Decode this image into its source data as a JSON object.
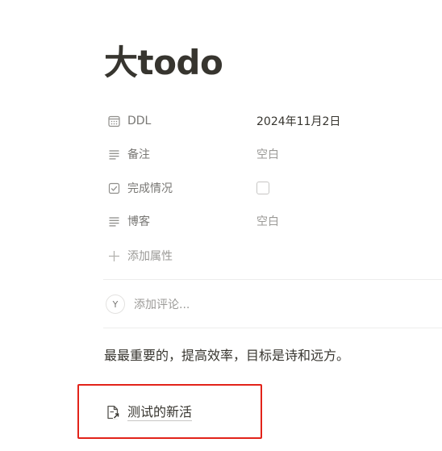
{
  "page": {
    "title": "大todo",
    "body_text": "最最重要的，提高效率，目标是诗和远方。"
  },
  "properties": [
    {
      "icon": "calendar-icon",
      "name": "DDL",
      "value": "2024年11月2日"
    },
    {
      "icon": "text-lines-icon",
      "name": "备注",
      "value": "空白"
    },
    {
      "icon": "checkbox-icon",
      "name": "完成情况",
      "value": ""
    },
    {
      "icon": "text-lines-icon",
      "name": "博客",
      "value": "空白"
    }
  ],
  "add_property_label": "添加属性",
  "comment": {
    "avatar_initial": "Y",
    "placeholder": "添加评论..."
  },
  "subpage_link": {
    "icon": "page-link-icon",
    "label": "测试的新活"
  },
  "colors": {
    "highlight": "#e2231a",
    "text": "#37352f",
    "muted": "#9b9a97"
  }
}
